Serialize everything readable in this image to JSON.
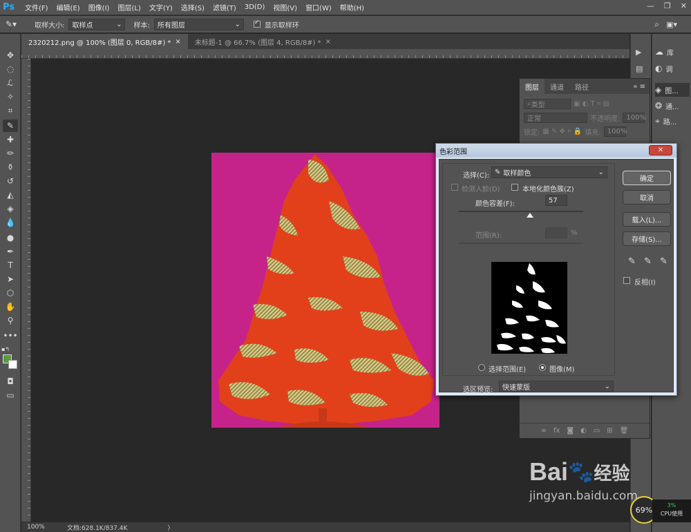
{
  "app": {
    "logo": "Ps"
  },
  "menu": [
    "文件(F)",
    "编辑(E)",
    "图像(I)",
    "图层(L)",
    "文字(Y)",
    "选择(S)",
    "滤镜(T)",
    "3D(D)",
    "视图(V)",
    "窗口(W)",
    "帮助(H)"
  ],
  "options": {
    "sample_size_label": "取样大小:",
    "sample_size_value": "取样点",
    "sample_label": "样本:",
    "sample_value": "所有图层",
    "show_ring_label": "显示取样环"
  },
  "tabs": [
    {
      "label": "2320212.png @ 100% (图层 0, RGB/8#) *",
      "close": "×"
    },
    {
      "label": "未标题-1 @ 66.7% (图层 4, RGB/8#) *",
      "close": "×"
    }
  ],
  "status": {
    "zoom": "100%",
    "doc": "文档:628.1K/837.4K",
    "arrow": "〉"
  },
  "dock": {
    "items": [
      {
        "icon": "libraries-icon",
        "label": "库"
      },
      {
        "icon": "adjustments-icon",
        "label": "调"
      },
      {
        "icon": "layers-icon",
        "label": "图..."
      },
      {
        "icon": "channels-icon",
        "label": "通..."
      },
      {
        "icon": "paths-icon",
        "label": "路..."
      }
    ]
  },
  "layers_panel": {
    "tabs": [
      "图层",
      "通道",
      "路径"
    ],
    "filter_placeholder": "类型",
    "blend_mode": "正常",
    "opacity_label": "不透明度:",
    "opacity_value": "100%",
    "lock_label": "锁定:",
    "fill_label": "填充:",
    "fill_value": "100%"
  },
  "dialog": {
    "title": "色彩范围",
    "close": "✕",
    "select_label": "选择(C):",
    "select_value": "取样颜色",
    "detect_faces": "检测人脸(D)",
    "localized": "本地化颜色簇(Z)",
    "fuzziness_label": "颜色容差(F):",
    "fuzziness_value": "57",
    "range_label": "范围(R):",
    "range_unit": "%",
    "radio_selection": "选择范围(E)",
    "radio_image": "图像(M)",
    "preview_label": "选区预览:",
    "preview_value": "快速蒙版",
    "ok": "确定",
    "cancel": "取消",
    "load": "载入(L)...",
    "save": "存储(S)...",
    "invert": "反相(I)",
    "fuzziness_fraction": 0.57
  },
  "watermark": {
    "brand": "Bai",
    "brand2": "经验",
    "url": "jingyan.baidu.com"
  },
  "cpu": {
    "percent": "3%",
    "label": "CPU使用",
    "circle": "69%"
  }
}
